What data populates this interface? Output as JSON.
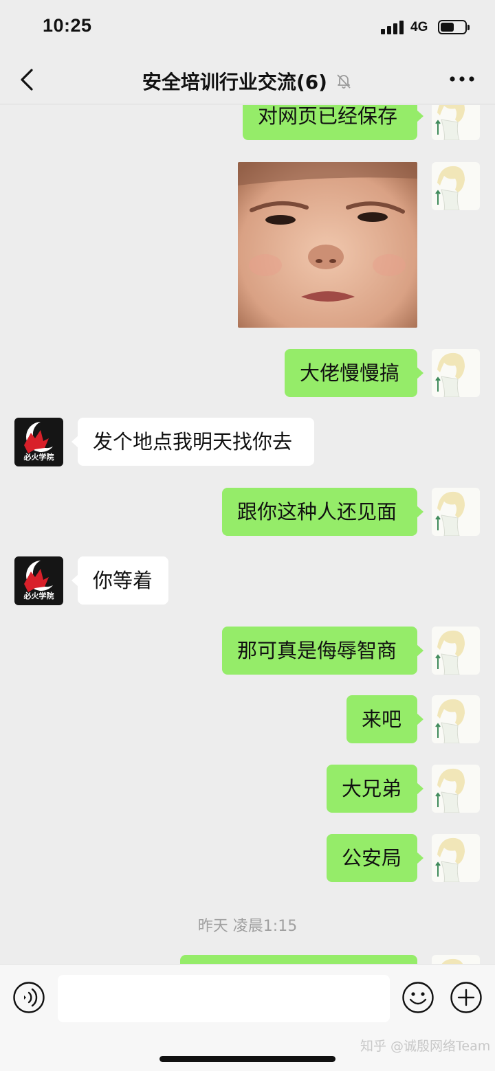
{
  "status_bar": {
    "time": "10:25",
    "network": "4G",
    "battery_level": 0.55
  },
  "nav": {
    "title": "安全培训行业交流(6)"
  },
  "colors": {
    "my_bubble": "#95ec69",
    "other_bubble": "#ffffff",
    "background": "#ededed"
  },
  "messages": [
    {
      "side": "right",
      "text": "对网页已经保存"
    },
    {
      "side": "right",
      "type": "sticker",
      "icon": "crying-child-sticker"
    },
    {
      "side": "right",
      "text": "大佬慢慢搞"
    },
    {
      "side": "left",
      "text": "发个地点我明天找你去",
      "avatar_label": "必火学院"
    },
    {
      "side": "right",
      "text": "跟你这种人还见面"
    },
    {
      "side": "left",
      "text": "你等着",
      "avatar_label": "必火学院"
    },
    {
      "side": "right",
      "text": "那可真是侮辱智商"
    },
    {
      "side": "right",
      "text": "来吧"
    },
    {
      "side": "right",
      "text": "大兄弟"
    },
    {
      "side": "right",
      "text": "公安局"
    }
  ],
  "timestamp": "昨天 凌晨1:15",
  "input": {
    "value": "",
    "placeholder": ""
  },
  "watermark": "知乎 @诚殷网络Team"
}
